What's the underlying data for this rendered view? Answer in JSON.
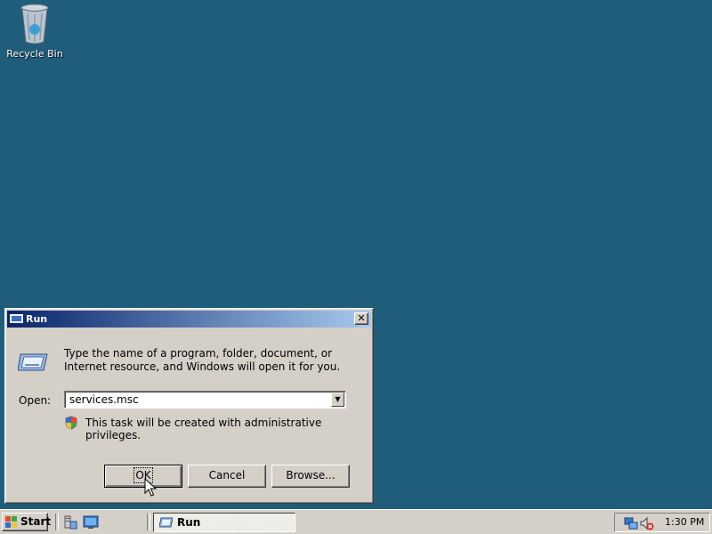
{
  "desktop": {
    "background_color": "#1f5d7a",
    "icons": [
      {
        "label": "Recycle Bin",
        "icon": "recycle-bin-icon"
      }
    ]
  },
  "run_dialog": {
    "title": "Run",
    "close_label": "✕",
    "description": "Type the name of a program, folder, document, or Internet resource, and Windows will open it for you.",
    "open_label": "Open:",
    "input_value": "services.msc",
    "admin_note": "This task will be created with administrative privileges.",
    "buttons": {
      "ok": "OK",
      "cancel": "Cancel",
      "browse": "Browse..."
    }
  },
  "taskbar": {
    "start_label": "Start",
    "quick_launch": [
      "server-manager-icon",
      "show-desktop-icon"
    ],
    "tasks": [
      {
        "label": "Run",
        "active": true
      }
    ],
    "tray_icons": [
      "network-icon",
      "volume-muted-icon"
    ],
    "clock": "1:30 PM"
  }
}
